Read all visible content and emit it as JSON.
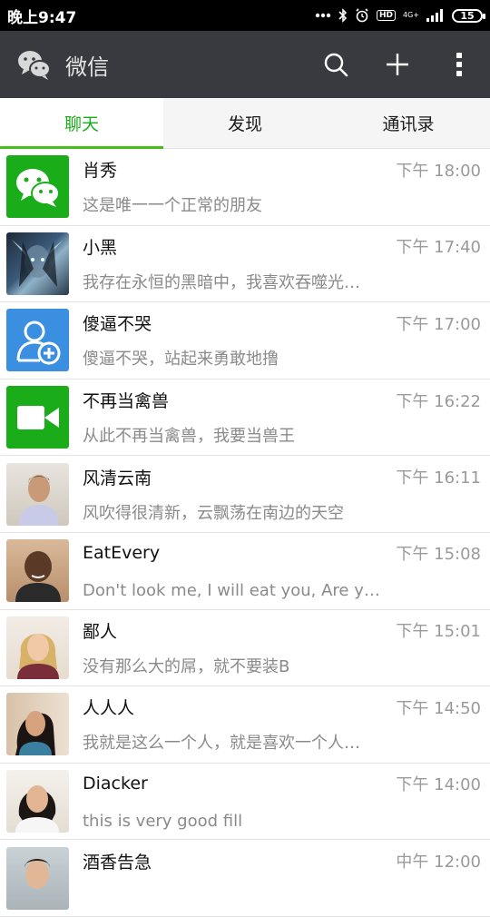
{
  "status_bar": {
    "time": "晚上9:47",
    "signal_label": "4G+",
    "hd_label": "HD",
    "battery": "15"
  },
  "app_bar": {
    "title": "微信",
    "icons": [
      "wechat-logo-icon",
      "search-icon",
      "plus-icon",
      "more-vertical-icon"
    ]
  },
  "tabs": [
    {
      "label": "聊天",
      "active": true
    },
    {
      "label": "发现",
      "active": false
    },
    {
      "label": "通讯录",
      "active": false
    }
  ],
  "chats": [
    {
      "name": "肖秀",
      "time": "下午 18:00",
      "preview": "这是唯一一个正常的朋友",
      "avatar": "wechat-logo"
    },
    {
      "name": "小黑",
      "time": "下午 17:40",
      "preview": "我存在永恒的黑暗中，我喜欢吞噬光…",
      "avatar": "dark-elf-photo"
    },
    {
      "name": "傻逼不哭",
      "time": "下午 17:00",
      "preview": "傻逼不哭，站起来勇敢地撸",
      "avatar": "add-contact"
    },
    {
      "name": "不再当禽兽",
      "time": "下午 16:22",
      "preview": "从此不再当禽兽，我要当兽王",
      "avatar": "video-camera"
    },
    {
      "name": "风清云南",
      "time": "下午 16:11",
      "preview": "风吹得很清新，云飘荡在南边的天空",
      "avatar": "man-photo"
    },
    {
      "name": "EatEvery",
      "time": "下午 15:08",
      "preview": "Don't look me, I will eat you, Are you…",
      "avatar": "man-photo-2"
    },
    {
      "name": "鄙人",
      "time": "下午 15:01",
      "preview": "没有那么大的屌，就不要装B",
      "avatar": "woman-blonde-photo"
    },
    {
      "name": "人人人",
      "time": "下午 14:50",
      "preview": "我就是这么一个人，就是喜欢一个人…",
      "avatar": "woman-photo"
    },
    {
      "name": "Diacker",
      "time": "下午 14:00",
      "preview": "this is very good fill",
      "avatar": "woman-photo-2"
    },
    {
      "name": "酒香告急",
      "time": "中午 12:00",
      "preview": "",
      "avatar": "man-photo-3"
    }
  ],
  "colors": {
    "app_bar": "#393a3f",
    "accent_green": "#1aad19",
    "tab_indicator": "#45c01a",
    "add_contact_blue": "#3b8fe0"
  }
}
